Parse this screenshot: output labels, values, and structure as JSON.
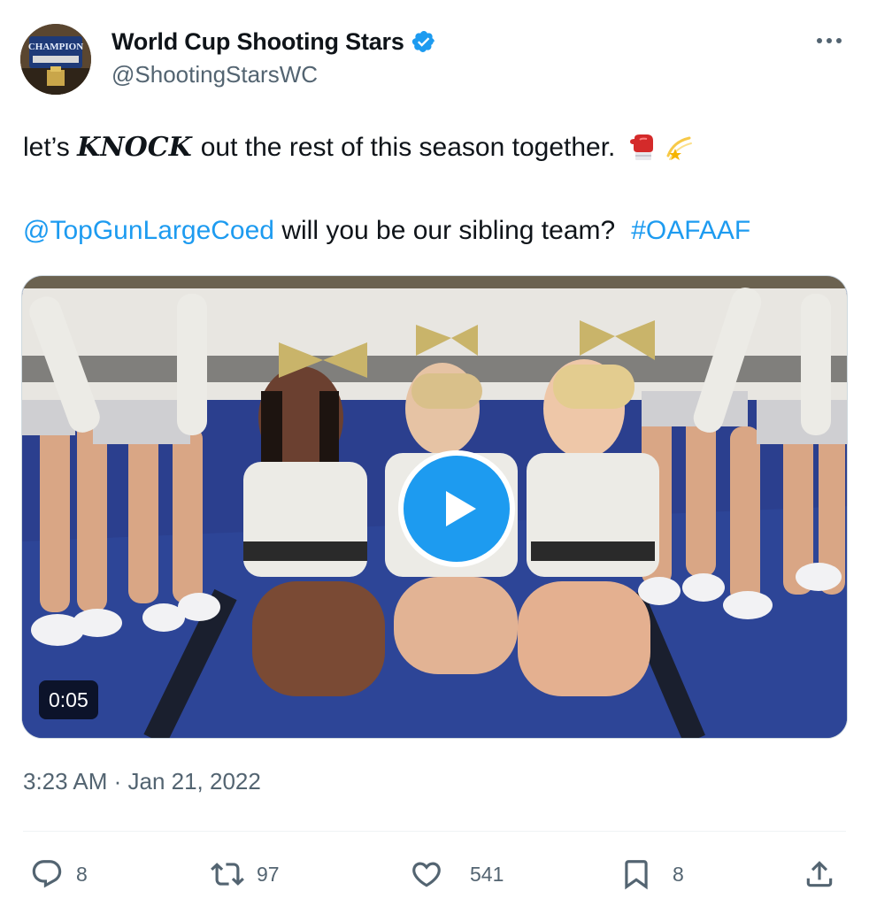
{
  "author": {
    "name": "World Cup Shooting Stars",
    "handle": "@ShootingStarsWC",
    "avatar_banner": "CHAMPION",
    "verified_color": "#1d9bf0"
  },
  "tweet": {
    "line1_before": "let’s ",
    "line1_emphasis": "KNOCK",
    "line1_after": "out the rest of this season together.",
    "emojis": [
      "boxing-glove",
      "dizzy-star"
    ],
    "mention": "@TopGunLargeCoed",
    "line2_middle": " will you be our sibling team?",
    "hashtag": "#OAFAAF"
  },
  "media": {
    "type": "video",
    "duration": "0:05",
    "play_icon": "play-icon"
  },
  "timestamp": "3:23 AM · Jan 21, 2022",
  "actions": {
    "reply_count": "8",
    "retweet_count": "97",
    "like_count": "541",
    "bookmark_count": "8"
  },
  "colors": {
    "accent": "#1d9bf0",
    "secondary_text": "#536471",
    "primary_text": "#0f1419"
  }
}
